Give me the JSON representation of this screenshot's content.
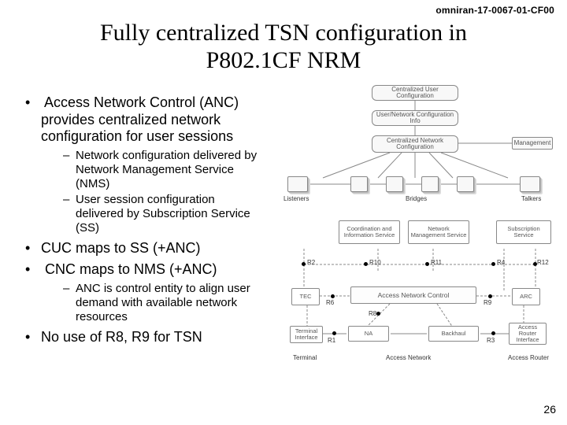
{
  "header_code": "omniran-17-0067-01-CF00",
  "title_line1": "Fully centralized TSN configuration in",
  "title_line2": "P802.1CF NRM",
  "bullets": {
    "b1": "Access Network Control (ANC) provides centralized network configuration for user sessions",
    "b1_subs": {
      "s1": "Network configuration delivered by Network Management Service (NMS)",
      "s2": "User session configuration delivered by Subscription Service (SS)"
    },
    "b2": "CUC maps to SS (+ANC)",
    "b3": "CNC maps to NMS (+ANC)",
    "b3_subs": {
      "s1": "ANC is control entity to align user demand with available network resources"
    },
    "b4": "No use of R8, R9 for TSN"
  },
  "page_num": "26",
  "fig1": {
    "top1": "Centralized User Configuration",
    "top2": "User/Network Configuration Info",
    "top3": "Centralized Network Configuration",
    "right": "Management",
    "left": "Listeners",
    "mid": "Bridges",
    "rgt": "Talkers"
  },
  "fig2": {
    "svc1": "Coordination and Information Service",
    "svc2": "Network Management Service",
    "svc3": "Subscription Service",
    "r2": "R2",
    "r10": "R10",
    "r11": "R11",
    "r4": "R4",
    "r12": "R12",
    "tec": "TEC",
    "anc": "Access Network Control",
    "arc": "ARC",
    "r6": "R6",
    "r8": "R8",
    "r9": "R9",
    "ti": "Terminal Interface",
    "na": "NA",
    "bh": "Backhaul",
    "ari": "Access Router Interface",
    "r1": "R1",
    "r3": "R3",
    "term": "Terminal",
    "an": "Access Network",
    "ar": "Access Router"
  }
}
